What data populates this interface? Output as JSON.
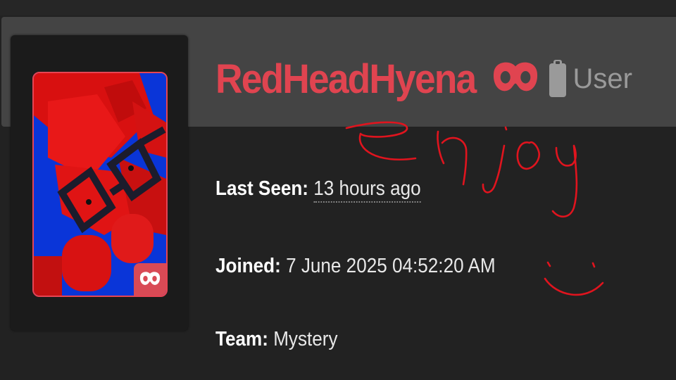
{
  "profile": {
    "username": "RedHeadHyena",
    "role": "User",
    "last_seen_label": "Last Seen:",
    "last_seen_value": "13 hours ago",
    "joined_label": "Joined:",
    "joined_value": "7 June 2025 04:52:20 AM",
    "team_label": "Team:",
    "team_value": "Mystery"
  },
  "icons": {
    "username_badge": "mask-icon",
    "role": "clipboard-icon",
    "avatar_badge": "mask-icon"
  },
  "handwriting": {
    "text": "enjoy"
  },
  "colors": {
    "accent": "#e04450",
    "background": "#222222",
    "header_band": "#444444",
    "role_text": "#9a9a9a",
    "scribble": "#e0141e"
  }
}
